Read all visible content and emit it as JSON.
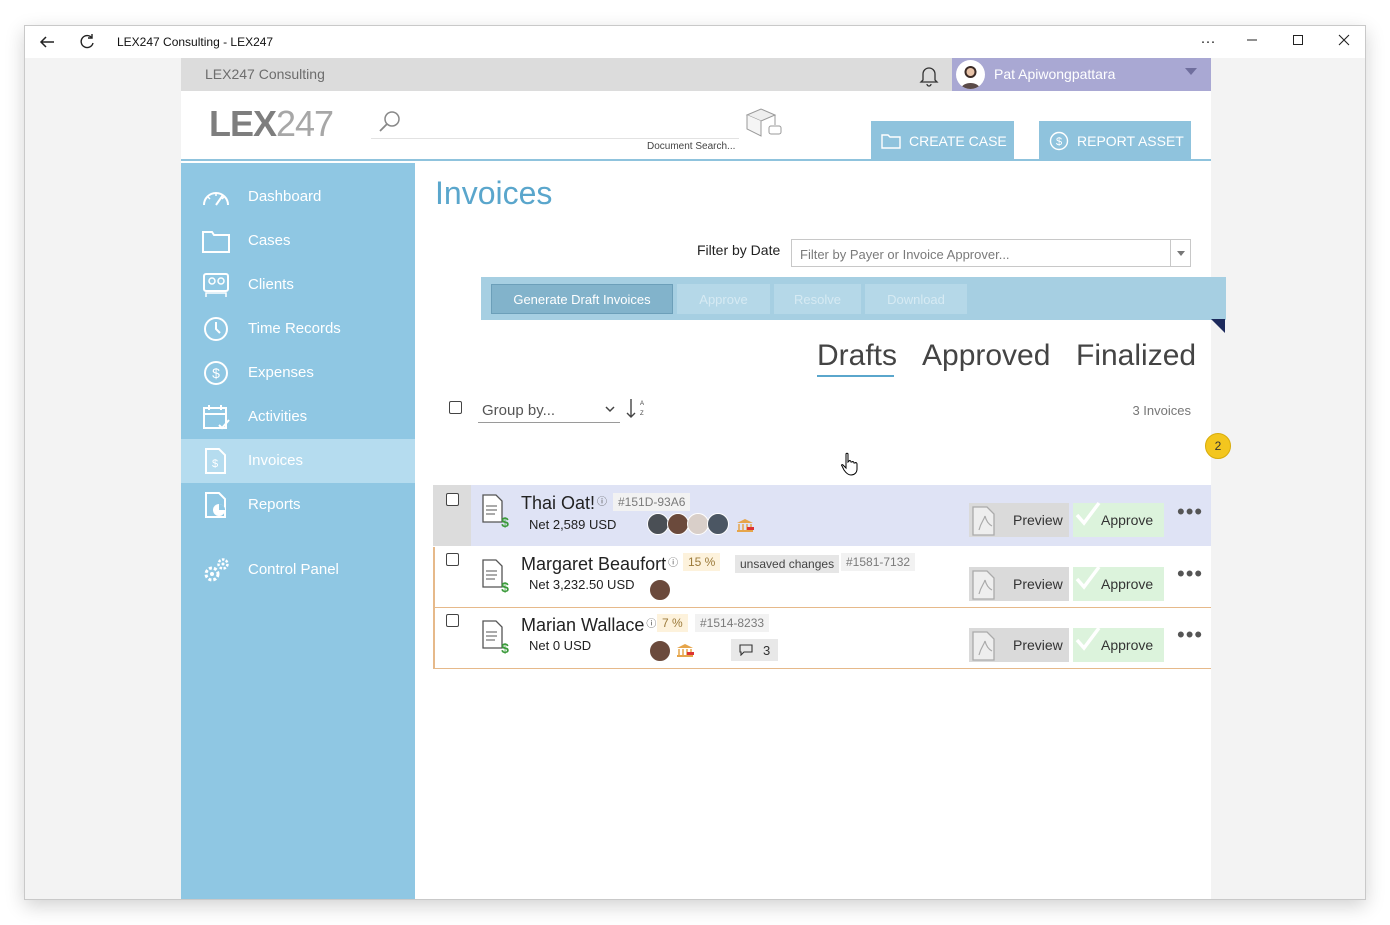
{
  "window": {
    "title": "LEX247 Consulting - LEX247",
    "icons": [
      "back-arrow-icon",
      "refresh-icon",
      "more-icon",
      "minimize-icon",
      "maximize-icon",
      "close-icon"
    ]
  },
  "topbar": {
    "firm_name": "LEX247 Consulting",
    "user_name": "Pat Apiwongpattara"
  },
  "header": {
    "logo_main": "LEX",
    "logo_num": "247",
    "search_placeholder": "",
    "search_hint": "Document Search...",
    "create_case": "CREATE CASE",
    "report_asset": "REPORT ASSET"
  },
  "sidebar": {
    "items": [
      {
        "label": "Dashboard",
        "icon": "gauge-icon"
      },
      {
        "label": "Cases",
        "icon": "folder-icon"
      },
      {
        "label": "Clients",
        "icon": "clients-icon"
      },
      {
        "label": "Time Records",
        "icon": "clock-icon"
      },
      {
        "label": "Expenses",
        "icon": "dollar-icon"
      },
      {
        "label": "Activities",
        "icon": "calendar-icon"
      },
      {
        "label": "Invoices",
        "icon": "invoice-icon"
      },
      {
        "label": "Reports",
        "icon": "report-icon"
      },
      {
        "label": "Control Panel",
        "icon": "gears-icon"
      }
    ],
    "active": "Invoices"
  },
  "main": {
    "title": "Invoices",
    "filter_label": "Filter by Date",
    "filter_placeholder": "Filter by Payer or Invoice Approver...",
    "toolbar": {
      "generate": "Generate Draft Invoices",
      "approve": "Approve",
      "resolve": "Resolve",
      "download": "Download"
    },
    "tabs": [
      "Drafts",
      "Approved",
      "Finalized"
    ],
    "active_tab": "Drafts",
    "group_by": "Group by...",
    "count": "3 Invoices",
    "rows": [
      {
        "name": "Thai Oat!",
        "net": "Net 2,589 USD",
        "id": "#151D-93A6",
        "pct": "",
        "unsaved": "",
        "comments": "",
        "preview": "Preview",
        "approve": "Approve"
      },
      {
        "name": "Margaret Beaufort",
        "net": "Net 3,232.50 USD",
        "id": "#1581-7132",
        "pct": "15 %",
        "unsaved": "unsaved changes",
        "comments": "",
        "preview": "Preview",
        "approve": "Approve"
      },
      {
        "name": "Marian Wallace",
        "net": "Net 0 USD",
        "id": "#1514-8233",
        "pct": "7 %",
        "unsaved": "",
        "comments": "3",
        "preview": "Preview",
        "approve": "Approve"
      }
    ],
    "badge": "2"
  },
  "colors": {
    "accent": "#8fc7e3",
    "title": "#5aa6cc",
    "user_bar": "#a9a8d3",
    "approve_bg": "#dcf3dc",
    "row_border": "#e6b98a",
    "badge": "#f3c61e"
  }
}
